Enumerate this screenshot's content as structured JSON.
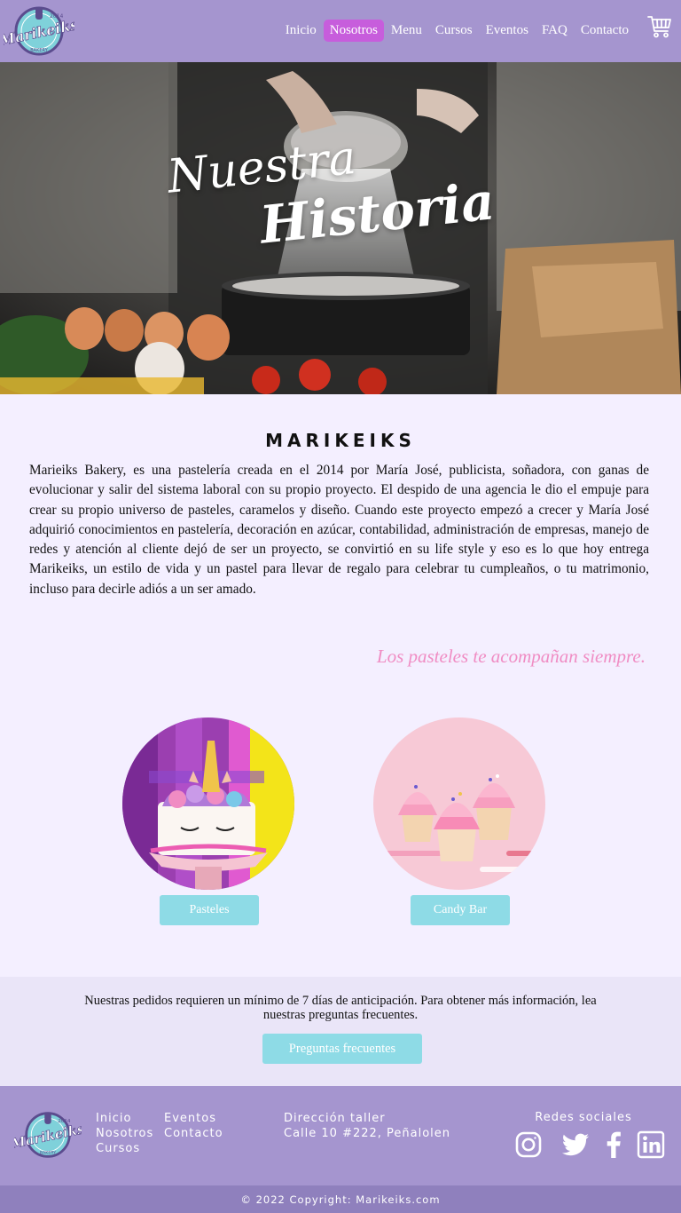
{
  "brand": {
    "name": "Marikeiks",
    "year": "2014",
    "tag": "BAKERY"
  },
  "nav": {
    "items": [
      {
        "label": "Inicio",
        "active": false
      },
      {
        "label": "Nosotros",
        "active": true
      },
      {
        "label": "Menu",
        "active": false
      },
      {
        "label": "Cursos",
        "active": false
      },
      {
        "label": "Eventos",
        "active": false
      },
      {
        "label": "FAQ",
        "active": false
      },
      {
        "label": "Contacto",
        "active": false
      }
    ],
    "cart_icon": "cart-icon"
  },
  "hero": {
    "line1": "Nuestra",
    "line2": "Historia"
  },
  "about": {
    "title": "MARIKEIKS",
    "text": "Marieiks Bakery, es una pastelería creada en el 2014 por María José, publicista, soñadora, con ganas de evolucionar y salir del sistema laboral con su propio proyecto.  El despido de una agencia le dio el empuje para crear su propio universo de pasteles, caramelos y diseño. Cuando este proyecto empezó a crecer y María José adquirió conocimientos en pastelería, decoración en azúcar, contabilidad, administración de empresas, manejo de redes y atención al cliente dejó de ser un proyecto, se convirtió en su life style y eso es lo que hoy entrega Marikeiks, un estilo de vida y un pastel para llevar de regalo para celebrar tu cumpleaños, o tu matrimonio, incluso para decirle adiós a un ser amado.",
    "tagline": "Los pasteles te acompañan siempre."
  },
  "categories": [
    {
      "label": "Pasteles"
    },
    {
      "label": "Candy Bar"
    }
  ],
  "notice": {
    "text": "Nuestras pedidos requieren un mínimo de 7 días de anticipación. Para obtener más información, lea nuestras preguntas frecuentes.",
    "button": "Preguntas frecuentes"
  },
  "footer": {
    "col1": [
      "Inicio",
      "Nosotros",
      "Cursos"
    ],
    "col2": [
      "Eventos",
      "Contacto"
    ],
    "address_label": "Dirección taller",
    "address": "Calle 10 #222, Peñalolen",
    "social_title": "Redes sociales",
    "social": [
      "instagram-icon",
      "twitter-icon",
      "facebook-icon",
      "linkedin-icon"
    ],
    "copyright": "© 2022 Copyright: Marikeiks.com"
  },
  "colors": {
    "nav_bg": "#a595cf",
    "active": "#c75ddc",
    "page_bg": "#f4efff",
    "button": "#8edbe6",
    "tagline": "#f08cc3",
    "footer_bottom": "#8f80bd"
  }
}
